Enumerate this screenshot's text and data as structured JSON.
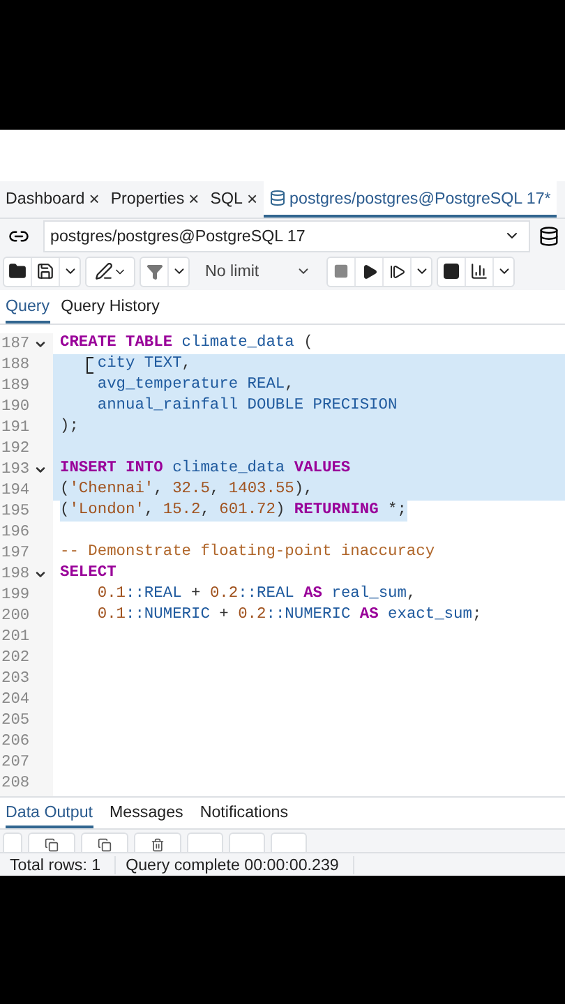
{
  "tabs": [
    {
      "label": "Dashboard",
      "closable": true,
      "selected": false
    },
    {
      "label": "Properties",
      "closable": true,
      "selected": false
    },
    {
      "label": "SQL",
      "closable": true,
      "selected": false
    },
    {
      "label": "postgres/postgres@PostgreSQL 17*",
      "closable": false,
      "selected": true
    }
  ],
  "close_glyph": "×",
  "connection": {
    "value": "postgres/postgres@PostgreSQL 17"
  },
  "toolbar": {
    "limit": "No limit"
  },
  "query_tabs": [
    {
      "label": "Query",
      "selected": true
    },
    {
      "label": "Query History",
      "selected": false
    }
  ],
  "editor": {
    "lines": [
      {
        "number": "187",
        "fold": true,
        "selected": false,
        "tokens": [
          {
            "kind": "keyword",
            "text": "CREATE TABLE"
          },
          {
            "kind": "ident",
            "text": " climate_data "
          },
          {
            "kind": "punct",
            "text": "("
          }
        ]
      },
      {
        "number": "188",
        "fold": false,
        "selected": true,
        "cursor": true,
        "tokens": [
          {
            "kind": "ident",
            "text": "    city TEXT"
          },
          {
            "kind": "punct",
            "text": ","
          }
        ]
      },
      {
        "number": "189",
        "fold": false,
        "selected": true,
        "tokens": [
          {
            "kind": "ident",
            "text": "    avg_temperature REAL"
          },
          {
            "kind": "punct",
            "text": ","
          }
        ]
      },
      {
        "number": "190",
        "fold": false,
        "selected": true,
        "tokens": [
          {
            "kind": "ident",
            "text": "    annual_rainfall DOUBLE PRECISION"
          }
        ]
      },
      {
        "number": "191",
        "fold": false,
        "selected": true,
        "tokens": [
          {
            "kind": "punct",
            "text": ");"
          }
        ]
      },
      {
        "number": "192",
        "fold": false,
        "selected": true
      },
      {
        "number": "193",
        "fold": true,
        "selected": true,
        "tokens": [
          {
            "kind": "keyword",
            "text": "INSERT INTO"
          },
          {
            "kind": "ident",
            "text": " climate_data "
          },
          {
            "kind": "keyword",
            "text": "VALUES"
          }
        ]
      },
      {
        "number": "194",
        "fold": false,
        "selected": true,
        "tokens": [
          {
            "kind": "punct",
            "text": "("
          },
          {
            "kind": "string",
            "text": "'Chennai'"
          },
          {
            "kind": "punct",
            "text": ", "
          },
          {
            "kind": "number",
            "text": "32.5"
          },
          {
            "kind": "punct",
            "text": ", "
          },
          {
            "kind": "number",
            "text": "1403.55"
          },
          {
            "kind": "punct",
            "text": "),"
          }
        ]
      },
      {
        "number": "195",
        "fold": false,
        "selected": true,
        "tokens": [
          {
            "kind": "punct",
            "text": "("
          },
          {
            "kind": "string",
            "text": "'London'"
          },
          {
            "kind": "punct",
            "text": ", "
          },
          {
            "kind": "number",
            "text": "15.2"
          },
          {
            "kind": "punct",
            "text": ", "
          },
          {
            "kind": "number",
            "text": "601.72"
          },
          {
            "kind": "punct",
            "text": ") "
          },
          {
            "kind": "keyword",
            "text": "RETURNING"
          },
          {
            "kind": "punct",
            "text": " *;"
          }
        ]
      },
      {
        "number": "196",
        "fold": false,
        "selected": false
      },
      {
        "number": "197",
        "fold": false,
        "selected": false,
        "tokens": [
          {
            "kind": "comment",
            "text": "-- Demonstrate floating-point inaccuracy"
          }
        ]
      },
      {
        "number": "198",
        "fold": true,
        "selected": false,
        "tokens": [
          {
            "kind": "keyword",
            "text": "SELECT"
          }
        ]
      },
      {
        "number": "199",
        "fold": false,
        "selected": false,
        "tokens": [
          {
            "kind": "number",
            "text": "    0.1"
          },
          {
            "kind": "ident",
            "text": "::REAL "
          },
          {
            "kind": "punct",
            "text": "+ "
          },
          {
            "kind": "number",
            "text": "0.2"
          },
          {
            "kind": "ident",
            "text": "::REAL "
          },
          {
            "kind": "keyword",
            "text": "AS"
          },
          {
            "kind": "ident",
            "text": " real_sum"
          },
          {
            "kind": "punct",
            "text": ","
          }
        ]
      },
      {
        "number": "200",
        "fold": false,
        "selected": false,
        "tokens": [
          {
            "kind": "number",
            "text": "    0.1"
          },
          {
            "kind": "ident",
            "text": "::NUMERIC "
          },
          {
            "kind": "punct",
            "text": "+ "
          },
          {
            "kind": "number",
            "text": "0.2"
          },
          {
            "kind": "ident",
            "text": "::NUMERIC "
          },
          {
            "kind": "keyword",
            "text": "AS"
          },
          {
            "kind": "ident",
            "text": " exact_sum"
          },
          {
            "kind": "punct",
            "text": ";"
          }
        ]
      },
      {
        "number": "201",
        "fold": false,
        "selected": false
      },
      {
        "number": "202",
        "fold": false,
        "selected": false
      },
      {
        "number": "203",
        "fold": false,
        "selected": false
      },
      {
        "number": "204",
        "fold": false,
        "selected": false
      },
      {
        "number": "205",
        "fold": false,
        "selected": false
      },
      {
        "number": "206",
        "fold": false,
        "selected": false
      },
      {
        "number": "207",
        "fold": false,
        "selected": false
      },
      {
        "number": "208",
        "fold": false,
        "selected": false
      }
    ]
  },
  "output_tabs": [
    {
      "label": "Data Output",
      "selected": true
    },
    {
      "label": "Messages",
      "selected": false
    },
    {
      "label": "Notifications",
      "selected": false
    }
  ],
  "status_bar": {
    "rows": "Total rows: 1",
    "message": "Query complete 00:00:00.239"
  }
}
